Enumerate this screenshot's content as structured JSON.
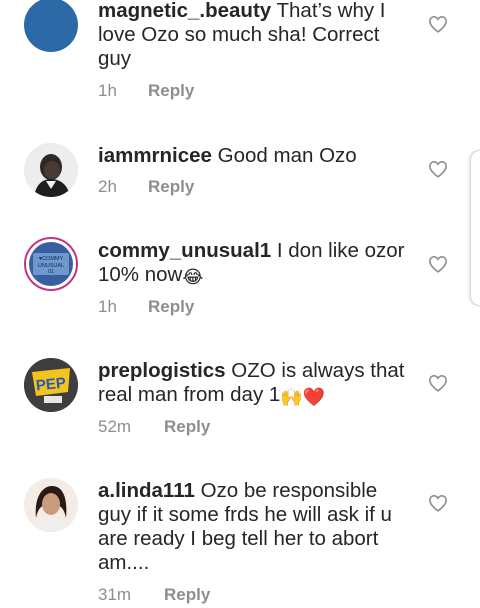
{
  "comments": [
    {
      "username": "magnetic_.beauty",
      "text": "That’s why I love Ozo so much sha! Correct guy",
      "time": "1h",
      "reply_label": "Reply",
      "avatar_color": "#2b6aa6",
      "avatar_icon": "blue-circle-avatar",
      "heart_icon": "heart-outline-icon"
    },
    {
      "username": "iammrnicee",
      "text": "Good man Ozo",
      "time": "2h",
      "reply_label": "Reply",
      "avatar_icon": "man-portrait-avatar",
      "heart_icon": "heart-outline-icon"
    },
    {
      "username": "commy_unusual1",
      "text": "I don like ozor 10% now",
      "emoji": "😂",
      "time": "1h",
      "reply_label": "Reply",
      "avatar_text": "COMMY UNUSUAL 01",
      "avatar_icon": "lightbox-sign-avatar",
      "heart_icon": "heart-outline-icon"
    },
    {
      "username": "preplogistics",
      "text": "OZO is always that real man from day 1",
      "emoji": "🙌❤️",
      "time": "52m",
      "reply_label": "Reply",
      "avatar_text": "PEP",
      "avatar_icon": "prep-logo-avatar",
      "heart_icon": "heart-outline-icon"
    },
    {
      "username": "a.linda111",
      "text": "Ozo  be responsible guy if it some frds he will  ask if u are ready I beg tell her to abort am....",
      "time": "31m",
      "reply_label": "Reply",
      "avatar_icon": "woman-portrait-avatar",
      "heart_icon": "heart-outline-icon"
    }
  ],
  "colors": {
    "text": "#262626",
    "meta": "#8e8e8e"
  }
}
